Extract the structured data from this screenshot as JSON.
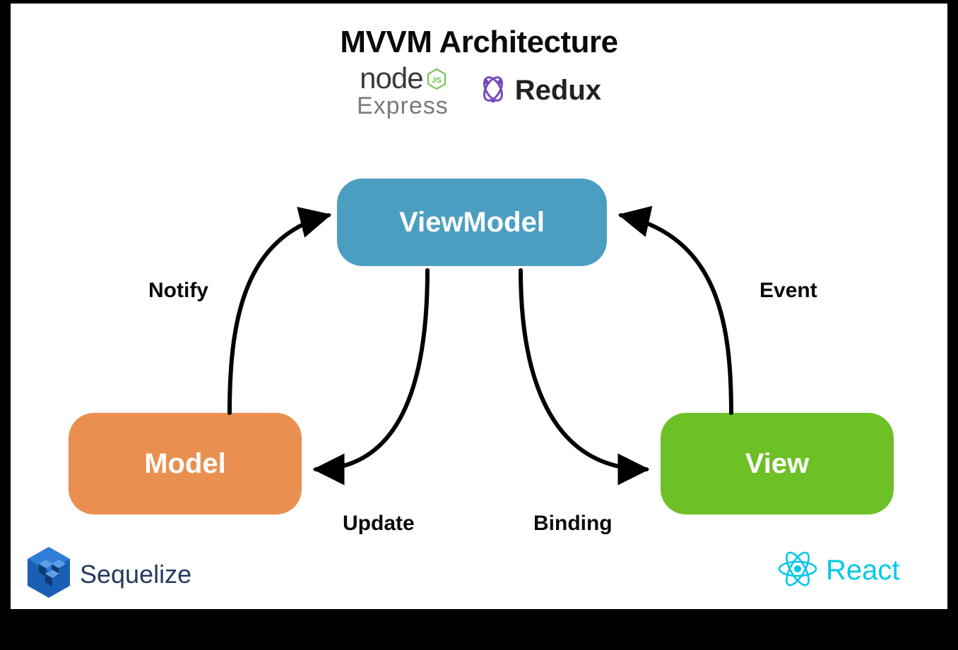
{
  "title": "MVVM Architecture",
  "boxes": {
    "viewmodel": "ViewModel",
    "model": "Model",
    "view": "View"
  },
  "arrows": {
    "notify": "Notify",
    "event": "Event",
    "update": "Update",
    "binding": "Binding"
  },
  "tech": {
    "node": "node",
    "express": "Express",
    "redux": "Redux",
    "sequelize": "Sequelize",
    "react": "React"
  },
  "colors": {
    "viewmodel": "#4a9ec1",
    "model": "#e99050",
    "view": "#6dc025",
    "react": "#00c8e6",
    "redux_purple": "#764abc",
    "sequelize_blue": "#1a5fb4"
  }
}
